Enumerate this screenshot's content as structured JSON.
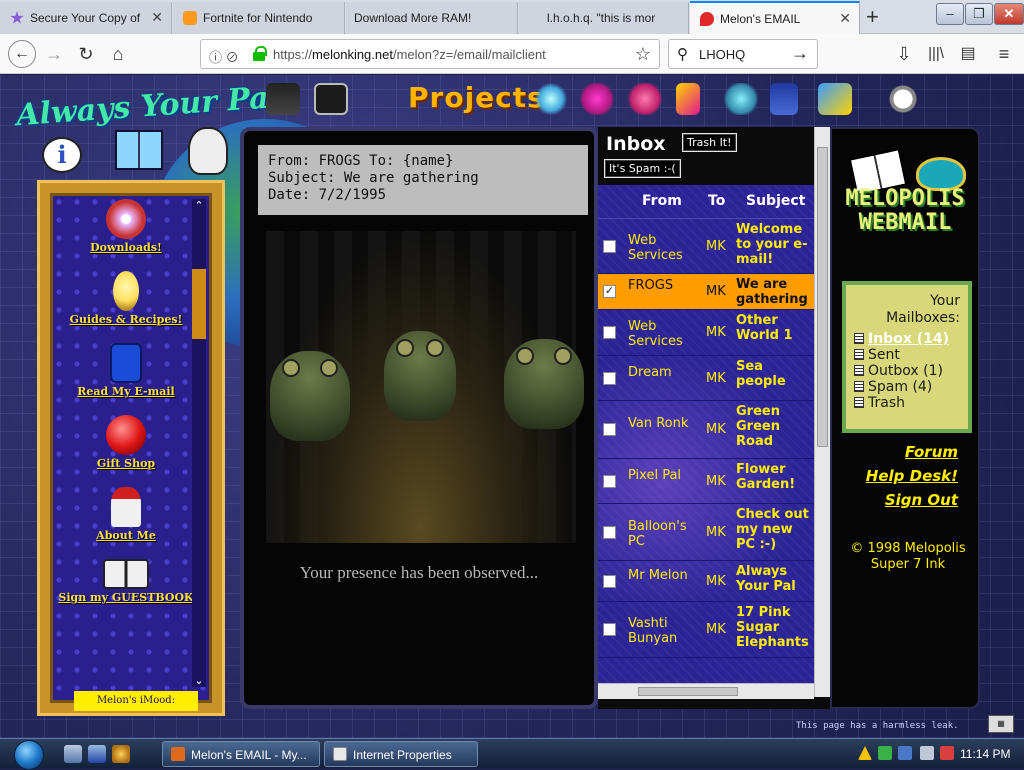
{
  "browser": {
    "tabs": [
      {
        "title": "Secure Your Copy of",
        "favicon_color": "#8c5cd8"
      },
      {
        "title": "Fortnite for Nintendo",
        "favicon_color": "#ff9a1e"
      },
      {
        "title": "Download More RAM!",
        "favicon_color": "#ffffff"
      },
      {
        "title": "l.h.o.h.q. \"this is mor",
        "favicon_color": "#ffffff"
      },
      {
        "title": "Melon's EMAIL",
        "favicon_color": "#e02828",
        "active": true
      }
    ],
    "new_tab_icon": "plus-icon",
    "url_prefix": "https://",
    "url_host": "melonking.net",
    "url_path": "/melon?z=/email/mailclient",
    "search_value": "LHOHQ"
  },
  "site": {
    "logo_text": "Always Your Pal",
    "projects_label": "Projects",
    "nav_items": [
      {
        "label": "Downloads!",
        "icon": "cd-icon",
        "color": "#c83232"
      },
      {
        "label": "Guides & Recipes!",
        "icon": "lightbulb-icon",
        "color": "#ffe060"
      },
      {
        "label": "Read My E-mail",
        "icon": "mailbox-icon",
        "color": "#1a4cd8"
      },
      {
        "label": "Gift Shop",
        "icon": "gift-icon",
        "color": "#e01818"
      },
      {
        "label": "About Me",
        "icon": "wizard-icon",
        "color": "#e8e8e8"
      },
      {
        "label": "Sign my GUESTBOOK",
        "icon": "guestbook-icon",
        "color": "#f0f0f0"
      }
    ],
    "imood_label": "Melon's iMood:"
  },
  "email": {
    "from_line": "From: FROGS To: {name}",
    "subject_line": "Subject: We are gathering",
    "date_line": "Date: 7/2/1995",
    "body_text": "Your presence has been observed..."
  },
  "inbox": {
    "title": "Inbox",
    "trash_button": "Trash It!",
    "spam_button": "It's Spam :-(",
    "col_from": "From",
    "col_to": "To",
    "col_subject": "Subject",
    "rows": [
      {
        "from": "Web Services",
        "to": "MK",
        "subject": "Welcome to your e-mail!",
        "checked": false,
        "selected": false
      },
      {
        "from": "FROGS",
        "to": "MK",
        "subject": "We are gathering",
        "checked": true,
        "selected": true
      },
      {
        "from": "Web Services",
        "to": "MK",
        "subject": "Other World 1",
        "checked": false,
        "selected": false
      },
      {
        "from": "Dream",
        "to": "MK",
        "subject": "Sea people",
        "checked": false,
        "selected": false
      },
      {
        "from": "Van Ronk",
        "to": "MK",
        "subject": "Green Green Road",
        "checked": false,
        "selected": false
      },
      {
        "from": "Pixel Pal",
        "to": "MK",
        "subject": "Flower Garden!",
        "checked": false,
        "selected": false
      },
      {
        "from": "Balloon's PC",
        "to": "MK",
        "subject": "Check out my new PC :-)",
        "checked": false,
        "selected": false
      },
      {
        "from": "Mr Melon",
        "to": "MK",
        "subject": "Always Your Pal",
        "checked": false,
        "selected": false
      },
      {
        "from": "Vashti Bunyan",
        "to": "MK",
        "subject": "17 Pink Sugar Elephants",
        "checked": false,
        "selected": false
      }
    ]
  },
  "webmail": {
    "logo_line1": "MELOPOLIS",
    "logo_line2": "WEBMAIL",
    "mailboxes_title": "Your Mailboxes:",
    "mailboxes": [
      {
        "label": "Inbox (14)",
        "active": true
      },
      {
        "label": "Sent",
        "active": false
      },
      {
        "label": "Outbox (1)",
        "active": false
      },
      {
        "label": "Spam (4)",
        "active": false
      },
      {
        "label": "Trash",
        "active": false
      }
    ],
    "link_forum": "Forum",
    "link_help": "Help Desk!",
    "link_signout": "Sign Out",
    "copyright": "© 1998 Melopolis Super 7 Ink"
  },
  "footer_note": "This page has a harmless leak.",
  "taskbar": {
    "task_email": "Melon's EMAIL - My...",
    "task_internet": "Internet Properties",
    "clock": "11:14 PM"
  }
}
